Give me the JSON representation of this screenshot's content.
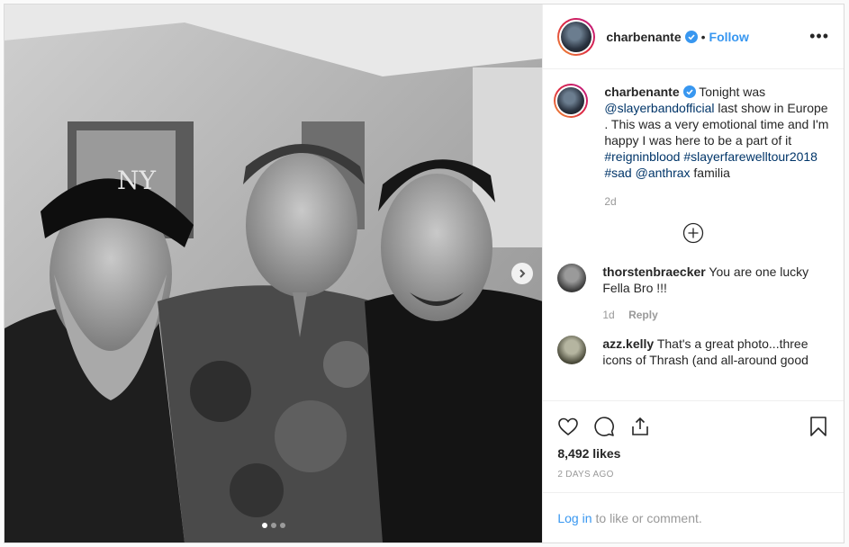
{
  "header": {
    "username": "charbenante",
    "separator": "•",
    "follow_label": "Follow",
    "more_label": "•••"
  },
  "caption": {
    "username": "charbenante",
    "text_1": "Tonight was",
    "mention_1": "@slayerbandofficial",
    "text_2": "last show in Europe . This was a very emotional time and I'm happy I was here to be a part of it",
    "tag_1": "#reigninblood",
    "tag_2": "#slayerfarewelltour2018",
    "tag_3": "#sad",
    "mention_2": "@anthrax",
    "text_3": "familia",
    "age": "2d"
  },
  "comments": [
    {
      "username": "thorstenbraecker",
      "text": "You are one lucky Fella Bro !!!",
      "age": "1d",
      "reply_label": "Reply"
    },
    {
      "username": "azz.kelly",
      "text": "That's a great photo...three icons of Thrash (and all-around good"
    }
  ],
  "footer": {
    "likes": "8,492 likes",
    "time_ago": "2 DAYS AGO",
    "login_link": "Log in",
    "login_text": "to like or comment."
  },
  "colors": {
    "accent": "#3897f0",
    "link": "#003569",
    "muted": "#999999"
  },
  "icons": [
    "heart-icon",
    "comment-icon",
    "share-icon",
    "bookmark-icon",
    "plus-circle-icon",
    "chevron-right-icon",
    "verified-badge-icon"
  ]
}
